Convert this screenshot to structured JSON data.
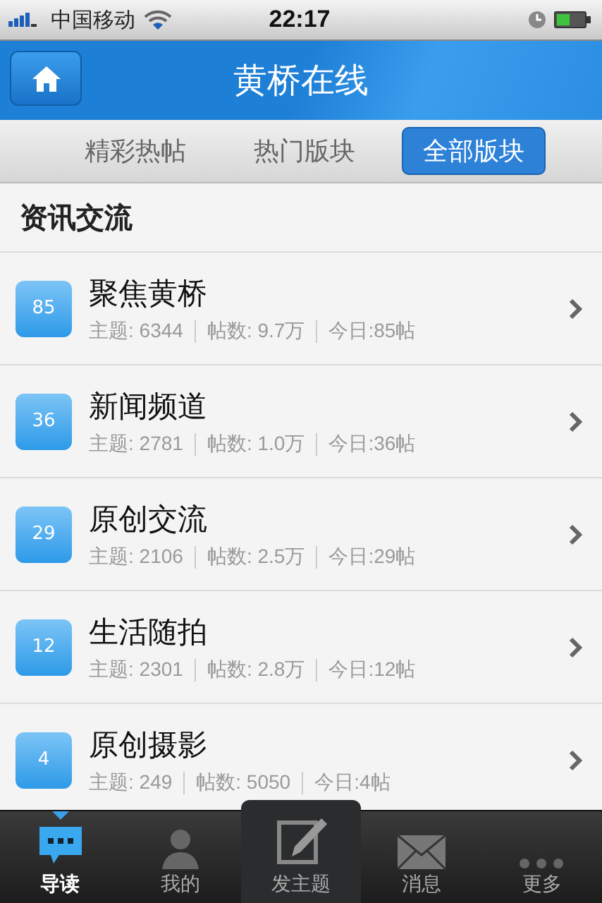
{
  "status_bar": {
    "carrier": "中国移动",
    "time": "22:17"
  },
  "nav_bar": {
    "title": "黄桥在线"
  },
  "tabs": [
    {
      "label": "精彩热帖",
      "selected": false
    },
    {
      "label": "热门版块",
      "selected": false
    },
    {
      "label": "全部版块",
      "selected": true
    }
  ],
  "section": {
    "title": "资讯交流"
  },
  "forums": [
    {
      "badge": "85",
      "name": "聚焦黄桥",
      "topics": "主题: 6344",
      "posts": "帖数: 9.7万",
      "today": "今日:85帖"
    },
    {
      "badge": "36",
      "name": "新闻频道",
      "topics": "主题: 2781",
      "posts": "帖数: 1.0万",
      "today": "今日:36帖"
    },
    {
      "badge": "29",
      "name": "原创交流",
      "topics": "主题: 2106",
      "posts": "帖数: 2.5万",
      "today": "今日:29帖"
    },
    {
      "badge": "12",
      "name": "生活随拍",
      "topics": "主题: 2301",
      "posts": "帖数: 2.8万",
      "today": "今日:12帖"
    },
    {
      "badge": "4",
      "name": "原创摄影",
      "topics": "主题: 249",
      "posts": "帖数: 5050",
      "today": "今日:4帖"
    }
  ],
  "tab_bar": [
    {
      "kind": "guide",
      "label": "导读",
      "selected": true
    },
    {
      "kind": "mine",
      "label": "我的",
      "selected": false
    },
    {
      "kind": "post",
      "label": "发主题",
      "selected": false
    },
    {
      "kind": "messages",
      "label": "消息",
      "selected": false
    },
    {
      "kind": "more",
      "label": "更多",
      "selected": false
    }
  ]
}
